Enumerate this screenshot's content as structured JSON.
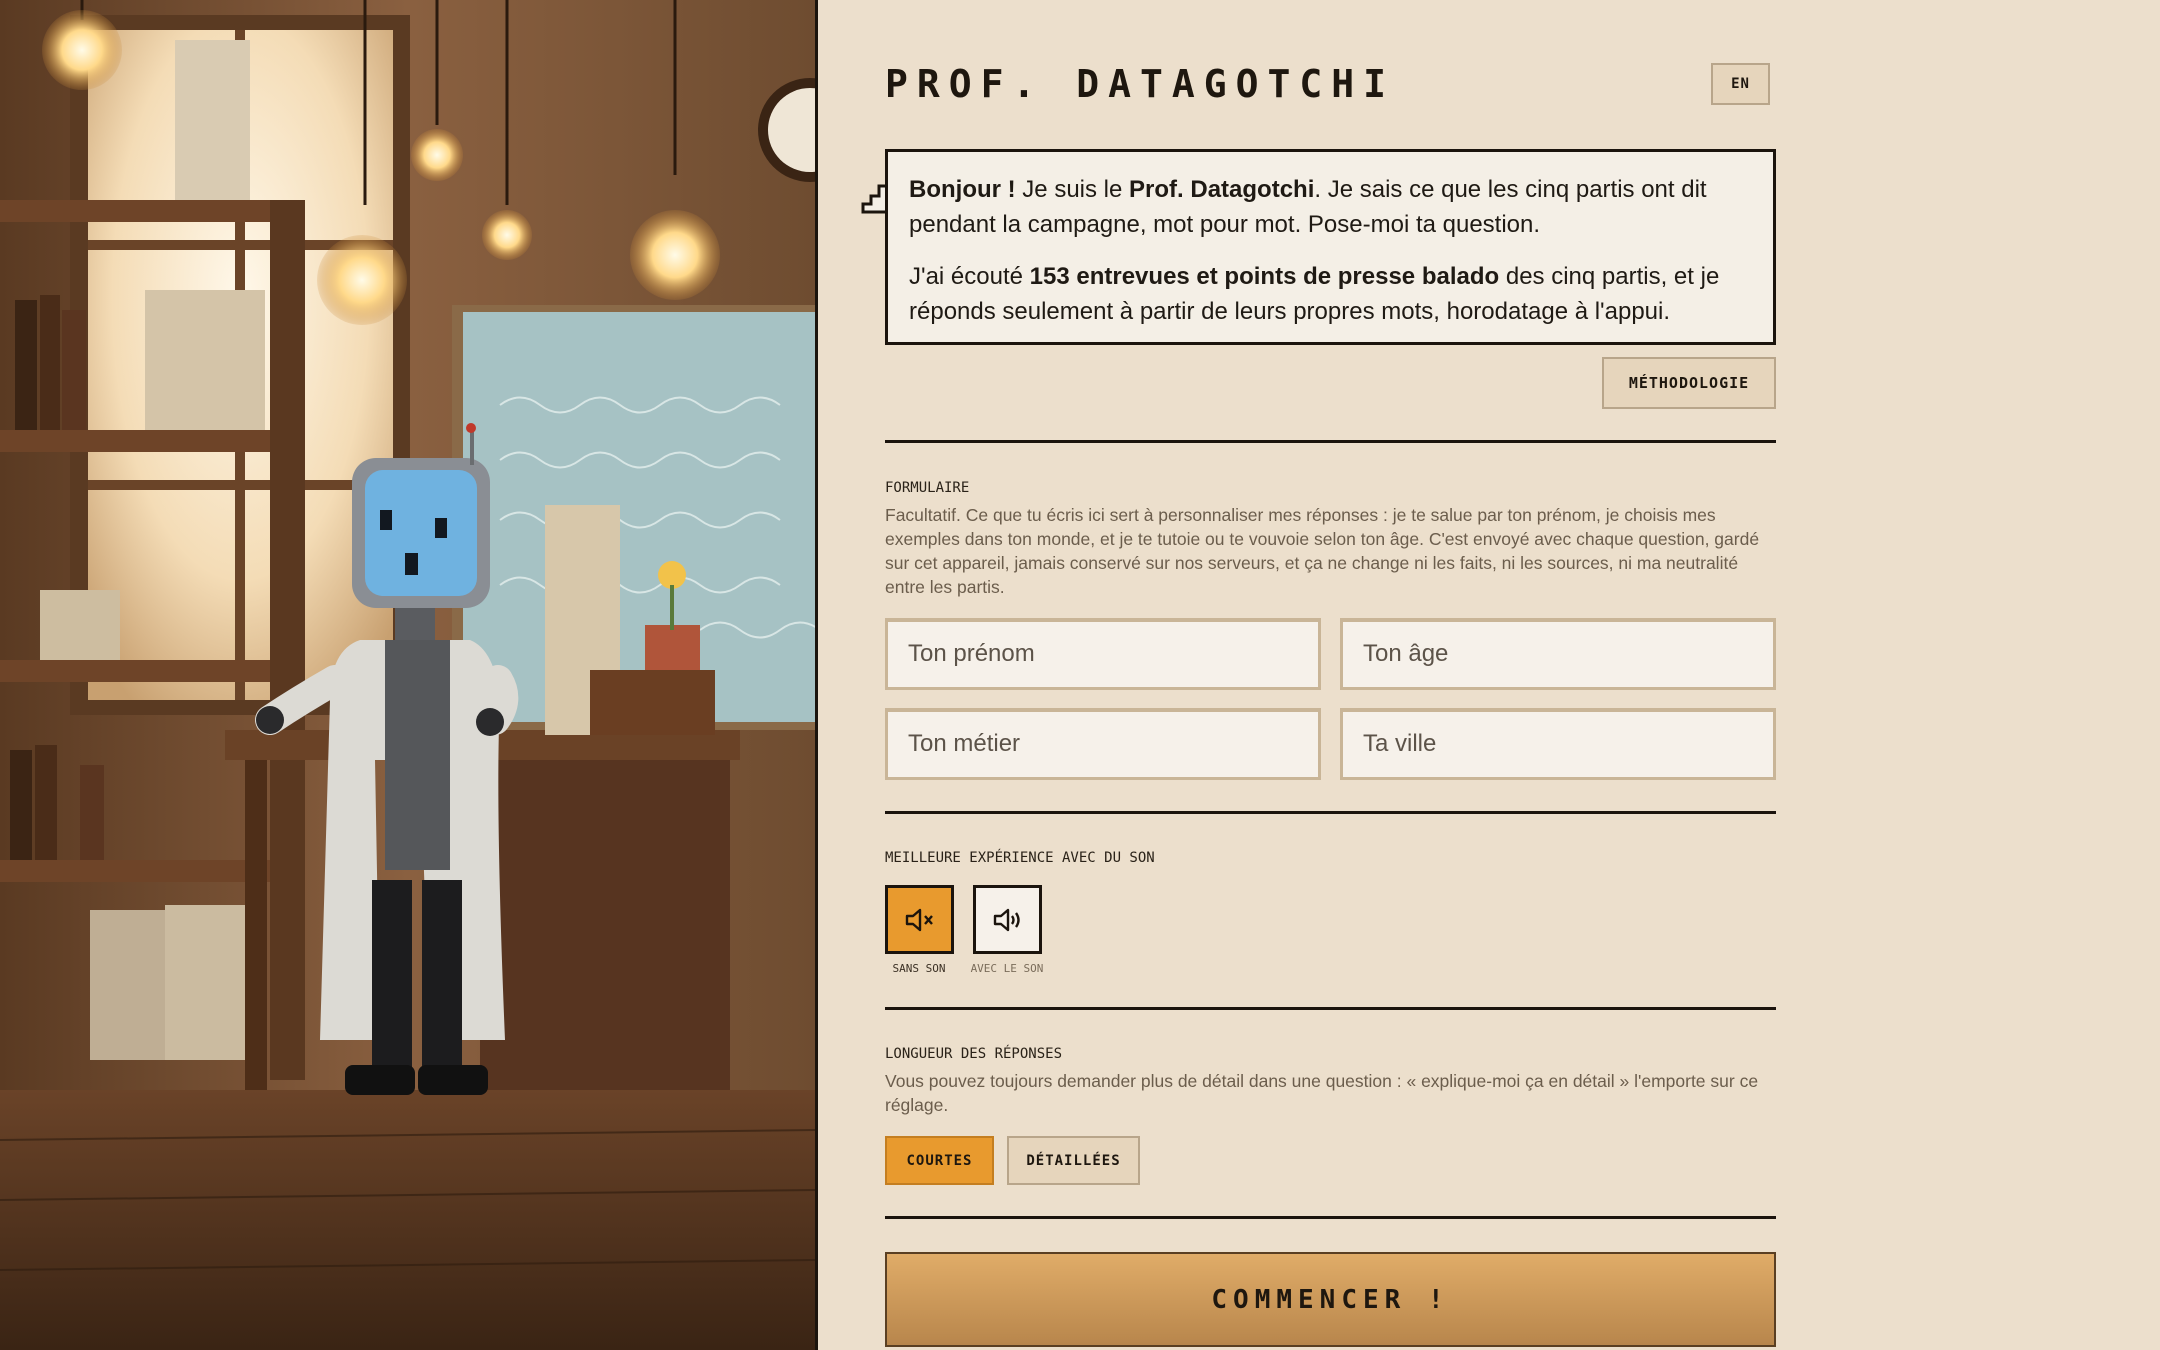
{
  "app": {
    "title": "PROF. DATAGOTCHI",
    "lang_button": "EN"
  },
  "intro": {
    "p1_greeting": "Bonjour !",
    "p1_a": " Je suis le ",
    "p1_name": "Prof. Datagotchi",
    "p1_b": ". Je sais ce que les cinq partis ont dit pendant la campagne, mot pour mot. Pose-moi ta question.",
    "p2_a": "J'ai écouté ",
    "p2_count": "153 entrevues et points de presse balado",
    "p2_b": " des cinq partis, et je réponds seulement à partir de leurs propres mots, horodatage à l'appui."
  },
  "methodology_button": "MÉTHODOLOGIE",
  "form": {
    "label": "FORMULAIRE",
    "description": "Facultatif. Ce que tu écris ici sert à personnaliser mes réponses : je te salue par ton prénom, je choisis mes exemples dans ton monde, et je te tutoie ou te vouvoie selon ton âge. C'est envoyé avec chaque question, gardé sur cet appareil, jamais conservé sur nos serveurs, et ça ne change ni les faits, ni les sources, ni ma neutralité entre les partis.",
    "fields": [
      {
        "placeholder": "Ton prénom",
        "value": ""
      },
      {
        "placeholder": "Ton âge",
        "value": ""
      },
      {
        "placeholder": "Ton métier",
        "value": ""
      },
      {
        "placeholder": "Ta ville",
        "value": ""
      }
    ]
  },
  "sound": {
    "label": "MEILLEURE EXPÉRIENCE AVEC DU SON",
    "options": [
      {
        "caption": "SANS SON",
        "icon": "speaker-mute-icon",
        "selected": true
      },
      {
        "caption": "AVEC LE SON",
        "icon": "speaker-on-icon",
        "selected": false
      }
    ]
  },
  "length": {
    "label": "LONGUEUR DES RÉPONSES",
    "description": "Vous pouvez toujours demander plus de détail dans une question : « explique-moi ça en détail » l'emporte sur ce réglage.",
    "options": [
      {
        "label": "COURTES",
        "selected": true
      },
      {
        "label": "DÉTAILLÉES",
        "selected": false
      }
    ]
  },
  "start_button": "COMMENCER !",
  "colors": {
    "background": "#ecdfcc",
    "accent": "#e89a2e",
    "border": "#1b140d",
    "button_bg": "#e6d5bc"
  }
}
